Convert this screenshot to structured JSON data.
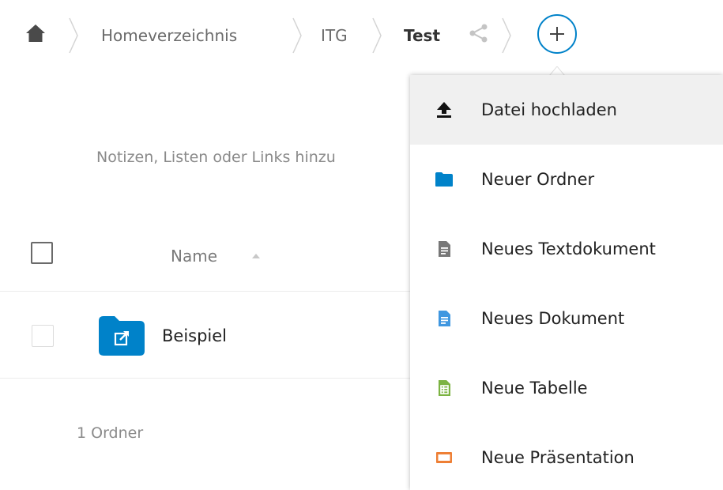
{
  "breadcrumb": {
    "home_icon": "home-icon",
    "items": [
      "Homeverzeichnis",
      "ITG",
      "Test"
    ],
    "share_icon": "share-icon",
    "new_button_icon": "plus-icon"
  },
  "main": {
    "notes_placeholder": "Notizen, Listen oder Links hinzu",
    "columns": {
      "name": "Name",
      "sort_icon": "sort-ascending-icon"
    },
    "rows": [
      {
        "name": "Beispiel",
        "icon": "shared-folder-icon"
      }
    ],
    "summary": "1 Ordner"
  },
  "new_menu": {
    "items": [
      {
        "label": "Datei hochladen",
        "icon": "upload-icon",
        "active": true
      },
      {
        "label": "Neuer Ordner",
        "icon": "folder-icon",
        "active": false
      },
      {
        "label": "Neues Textdokument",
        "icon": "text-document-icon",
        "active": false
      },
      {
        "label": "Neues Dokument",
        "icon": "document-icon",
        "active": false
      },
      {
        "label": "Neue Tabelle",
        "icon": "spreadsheet-icon",
        "active": false
      },
      {
        "label": "Neue Präsentation",
        "icon": "presentation-icon",
        "active": false
      }
    ]
  },
  "colors": {
    "accent": "#0082c9",
    "text_icon": "#777777",
    "document_icon": "#3f97e0",
    "spreadsheet_icon": "#7cb342",
    "presentation_icon": "#ee7f35"
  }
}
